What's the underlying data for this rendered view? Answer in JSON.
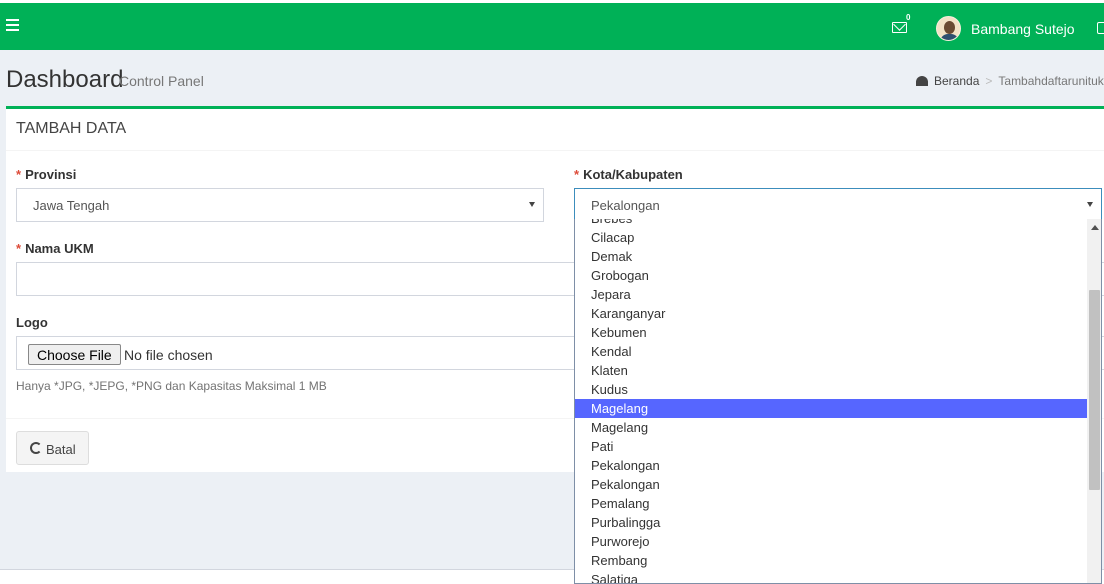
{
  "header": {
    "user_name": "Bambang Sutejo",
    "mail_count": "0",
    "brand_color": "#00b157"
  },
  "content_header": {
    "title": "Dashboard",
    "subtitle": "Control Panel",
    "breadcrumb": {
      "home": "Beranda",
      "current": "Tambahdaftarunituk"
    }
  },
  "form": {
    "box_title": "TAMBAH DATA",
    "required_mark": "*",
    "provinsi": {
      "label": "Provinsi",
      "value": "Jawa Tengah"
    },
    "kota": {
      "label": "Kota/Kabupaten",
      "value": "Pekalongan",
      "options": [
        "Brebes",
        "Cilacap",
        "Demak",
        "Grobogan",
        "Jepara",
        "Karanganyar",
        "Kebumen",
        "Kendal",
        "Klaten",
        "Kudus",
        "Magelang",
        "Magelang",
        "Pati",
        "Pekalongan",
        "Pekalongan",
        "Pemalang",
        "Purbalingga",
        "Purworejo",
        "Rembang",
        "Salatiga"
      ],
      "highlighted_index": 10
    },
    "nama_ukm": {
      "label": "Nama UKM",
      "value": ""
    },
    "logo": {
      "label": "Logo",
      "button": "Choose File",
      "status": "No file chosen",
      "help": "Hanya *JPG, *JEPG, *PNG dan Kapasitas Maksimal 1 MB"
    },
    "cancel_button": "Batal"
  }
}
